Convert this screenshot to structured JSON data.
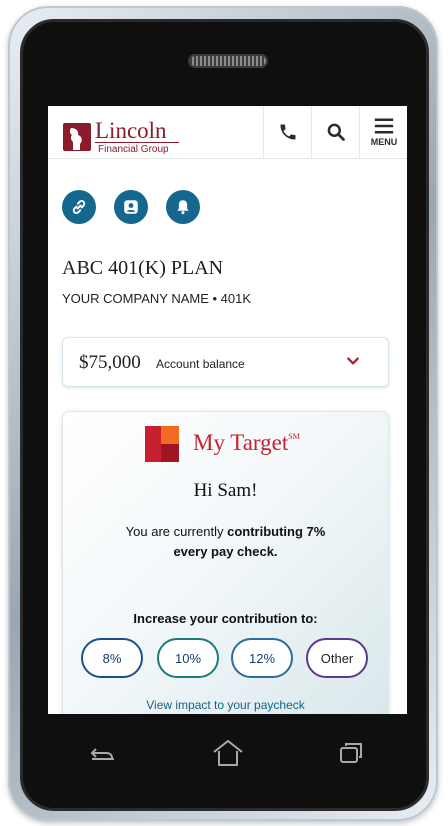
{
  "header": {
    "logo_name": "Lincoln",
    "logo_sub": "Financial Group",
    "menu_label": "MENU"
  },
  "plan": {
    "name": "ABC 401(K) PLAN",
    "company": "YOUR COMPANY NAME • 401K"
  },
  "balance": {
    "amount": "$75,000",
    "label": "Account balance"
  },
  "my_target": {
    "title": "My Target",
    "superscript": "SM",
    "greeting": "Hi Sam!",
    "contrib_prefix": "You are currently ",
    "contrib_bold": "contributing 7%",
    "contrib_line2": "every pay check.",
    "increase_label": "Increase your contribution to:",
    "options": [
      "8%",
      "10%",
      "12%",
      "Other"
    ],
    "link": "View impact to your paycheck"
  },
  "colors": {
    "brand_red": "#8a1c2b",
    "accent_blue": "#16678f",
    "target_red": "#c8202f",
    "pill_borders": [
      "#1c4f8c",
      "#1c7b7b",
      "#2a6e99",
      "#5b3a8e"
    ]
  },
  "icons": {
    "top_actions": [
      "link-icon",
      "user-icon",
      "bell-icon"
    ],
    "header": [
      "phone-icon",
      "search-icon",
      "menu-icon"
    ],
    "softkeys": [
      "back-icon",
      "home-icon",
      "recents-icon"
    ]
  }
}
